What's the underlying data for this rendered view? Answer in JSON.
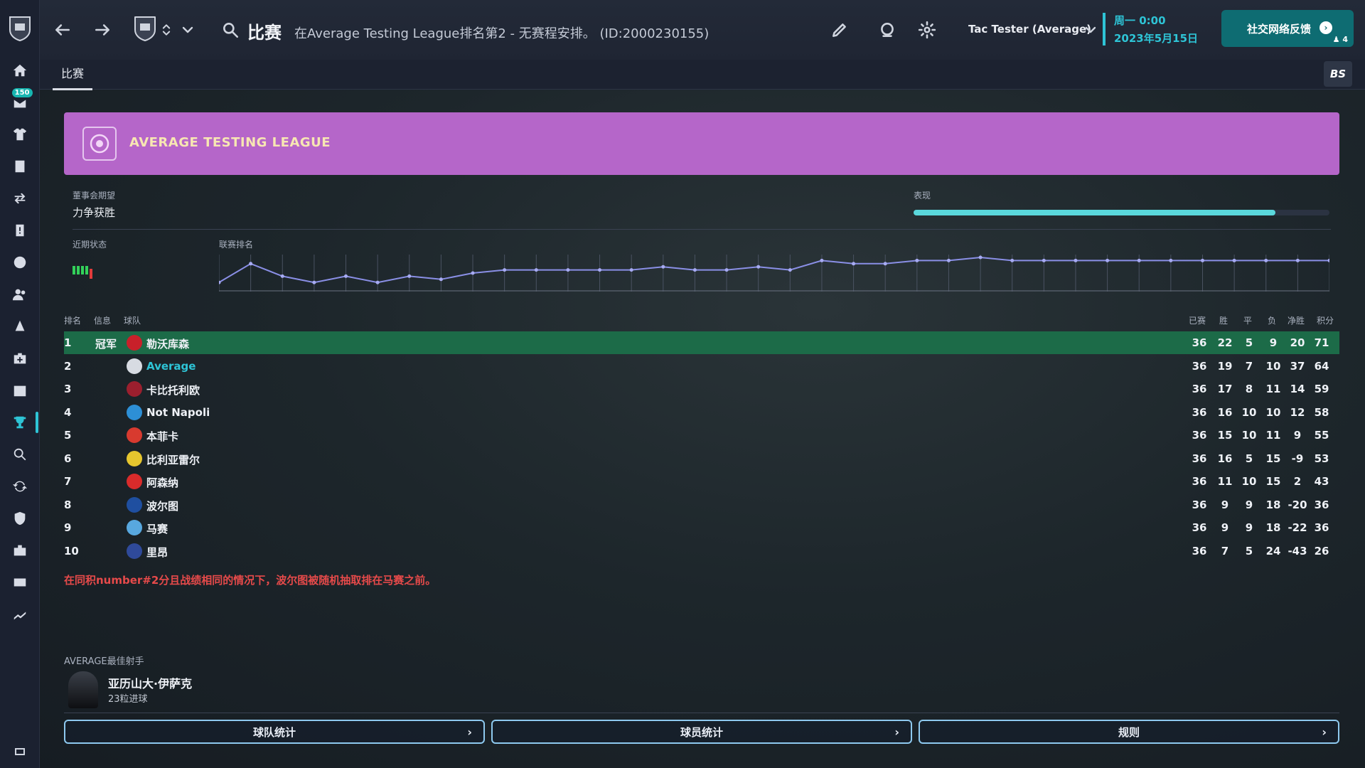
{
  "sidebar": {
    "mail_badge": "150",
    "items": [
      "home",
      "inbox",
      "squad",
      "tactics",
      "transfers",
      "reports",
      "training",
      "staff",
      "scouting",
      "medical",
      "calendar",
      "competitions",
      "search",
      "swap",
      "club",
      "finances",
      "trophy-room",
      "stats"
    ]
  },
  "topbar": {
    "title": "比赛",
    "subtitle": "在Average Testing League排名第2 - 无赛程安排。 (ID:2000230155)",
    "user": "Tac Tester (Average)",
    "date_line1": "周一 0:00",
    "date_line2": "2023年5月15日",
    "social_label": "社交网络反馈",
    "social_count": "4"
  },
  "subbar": {
    "tab": "比赛",
    "bs": "BS"
  },
  "league": {
    "name": "AVERAGE TESTING LEAGUE",
    "board_label": "董事会期望",
    "board_value": "力争获胜",
    "perf_label": "表现",
    "perf_value": 0.87,
    "form_label": "近期状态",
    "form": [
      "W",
      "W",
      "W",
      "W",
      "L"
    ],
    "rank_label": "联赛排名"
  },
  "chart_data": {
    "type": "line",
    "series": [
      {
        "values": [
          4,
          1,
          3,
          4,
          3,
          4,
          3,
          3.5,
          2.5,
          2,
          2,
          2,
          2,
          2,
          1.5,
          2,
          2,
          1.5,
          2,
          0.5,
          1,
          1,
          0.5,
          0.5,
          0,
          0.5,
          0.5,
          0.5,
          0.5,
          0.5,
          0.5,
          0.5,
          0.5,
          0.5,
          0.5,
          0.5
        ]
      }
    ],
    "ylim": [
      0,
      5
    ]
  },
  "table": {
    "headers": {
      "pos": "排名",
      "info": "信息",
      "team": "球队",
      "played": "已赛",
      "won": "胜",
      "drawn": "平",
      "lost": "负",
      "gd": "净胜",
      "pts": "积分"
    },
    "rows": [
      {
        "pos": "1",
        "info": "冠军",
        "team": "勒沃库森",
        "crest": "#c8202a",
        "p": "36",
        "w": "22",
        "d": "5",
        "l": "9",
        "gd": "20",
        "pts": "71"
      },
      {
        "pos": "2",
        "info": "",
        "team": "Average",
        "crest": "#d7dbe2",
        "p": "36",
        "w": "19",
        "d": "7",
        "l": "10",
        "gd": "37",
        "pts": "64"
      },
      {
        "pos": "3",
        "info": "",
        "team": "卡比托利欧",
        "crest": "#9b1f2e",
        "p": "36",
        "w": "17",
        "d": "8",
        "l": "11",
        "gd": "14",
        "pts": "59"
      },
      {
        "pos": "4",
        "info": "",
        "team": "Not Napoli",
        "crest": "#2d8fd6",
        "p": "36",
        "w": "16",
        "d": "10",
        "l": "10",
        "gd": "12",
        "pts": "58"
      },
      {
        "pos": "5",
        "info": "",
        "team": "本菲卡",
        "crest": "#d83a2f",
        "p": "36",
        "w": "15",
        "d": "10",
        "l": "11",
        "gd": "9",
        "pts": "55"
      },
      {
        "pos": "6",
        "info": "",
        "team": "比利亚雷尔",
        "crest": "#e6c62e",
        "p": "36",
        "w": "16",
        "d": "5",
        "l": "15",
        "gd": "-9",
        "pts": "53"
      },
      {
        "pos": "7",
        "info": "",
        "team": "阿森纳",
        "crest": "#d92b2b",
        "p": "36",
        "w": "11",
        "d": "10",
        "l": "15",
        "gd": "2",
        "pts": "43"
      },
      {
        "pos": "8",
        "info": "",
        "team": "波尔图",
        "crest": "#1f4fa0",
        "p": "36",
        "w": "9",
        "d": "9",
        "l": "18",
        "gd": "-20",
        "pts": "36"
      },
      {
        "pos": "9",
        "info": "",
        "team": "马赛",
        "crest": "#58a8df",
        "p": "36",
        "w": "9",
        "d": "9",
        "l": "18",
        "gd": "-22",
        "pts": "36"
      },
      {
        "pos": "10",
        "info": "",
        "team": "里昂",
        "crest": "#2f4a9a",
        "p": "36",
        "w": "7",
        "d": "5",
        "l": "24",
        "gd": "-43",
        "pts": "26"
      }
    ],
    "note": "在同积number#2分且战绩相同的情况下，波尔图被随机抽取排在马赛之前。"
  },
  "scorer": {
    "label": "AVERAGE最佳射手",
    "name": "亚历山大·伊萨克",
    "goals": "23粒进球"
  },
  "buttons": {
    "team_stats": "球队统计",
    "player_stats": "球员统计",
    "rules": "规则"
  },
  "colors": {
    "accent": "#2ec4d6",
    "banner": "#b566c9",
    "champion_row": "#1c6b48",
    "note": "#e64a4a"
  }
}
